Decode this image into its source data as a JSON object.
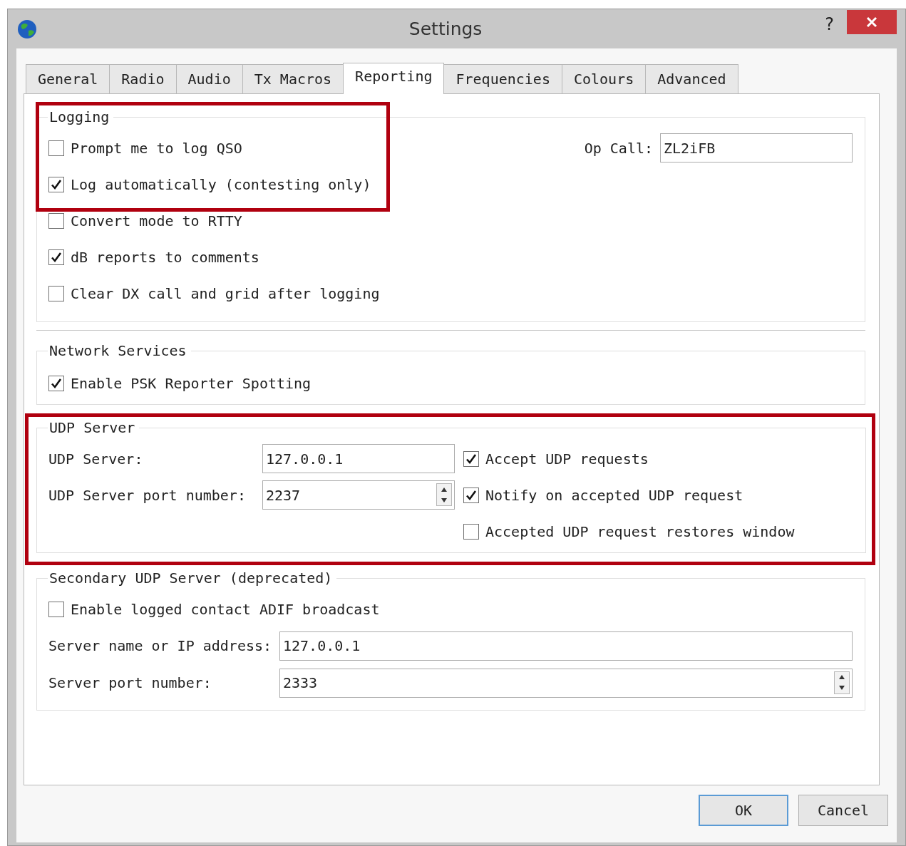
{
  "window": {
    "title": "Settings",
    "help": "?"
  },
  "tabs": [
    {
      "label": "General",
      "selected": false
    },
    {
      "label": "Radio",
      "selected": false
    },
    {
      "label": "Audio",
      "selected": false
    },
    {
      "label": "Tx Macros",
      "selected": false
    },
    {
      "label": "Reporting",
      "selected": true
    },
    {
      "label": "Frequencies",
      "selected": false
    },
    {
      "label": "Colours",
      "selected": false
    },
    {
      "label": "Advanced",
      "selected": false
    }
  ],
  "logging": {
    "title": "Logging",
    "highlighted": true,
    "framed_options": [
      {
        "label": "Prompt me to log QSO",
        "checked": false
      },
      {
        "label": "Log automatically (contesting only)",
        "checked": true
      }
    ],
    "options": [
      {
        "label": "Convert mode to RTTY",
        "checked": false
      },
      {
        "label": "dB reports to comments",
        "checked": true
      },
      {
        "label": "Clear DX call and grid after logging",
        "checked": false
      }
    ],
    "op_call": {
      "label": "Op Call:",
      "value": "ZL2iFB"
    }
  },
  "network_services": {
    "title": "Network Services",
    "options": [
      {
        "label": "Enable PSK Reporter Spotting",
        "checked": true
      }
    ]
  },
  "udp_server": {
    "title": "UDP Server",
    "highlighted": true,
    "server": {
      "label": "UDP Server:",
      "value": "127.0.0.1"
    },
    "port": {
      "label": "UDP Server port number:",
      "value": "2237"
    },
    "options": [
      {
        "label": "Accept UDP requests",
        "checked": true
      },
      {
        "label": "Notify on accepted UDP request",
        "checked": true
      },
      {
        "label": "Accepted UDP request restores window",
        "checked": false
      }
    ]
  },
  "secondary_udp_server": {
    "title": "Secondary UDP Server (deprecated)",
    "options": [
      {
        "label": "Enable logged contact ADIF broadcast",
        "checked": false
      }
    ],
    "server": {
      "label": "Server name or IP address:",
      "value": "127.0.0.1"
    },
    "port": {
      "label": "Server port number:",
      "value": "2333"
    }
  },
  "buttons": [
    "OK",
    "Cancel"
  ]
}
